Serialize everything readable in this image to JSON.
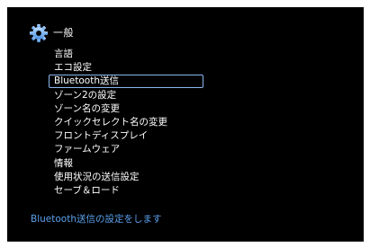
{
  "header": {
    "icon": "gear-icon",
    "title": "一般"
  },
  "menu": {
    "selected_index": 2,
    "items": [
      {
        "label": "言語"
      },
      {
        "label": "エコ設定"
      },
      {
        "label": "Bluetooth送信"
      },
      {
        "label": "ゾーン2の設定"
      },
      {
        "label": "ゾーン名の変更"
      },
      {
        "label": "クイックセレクト名の変更"
      },
      {
        "label": "フロントディスプレイ"
      },
      {
        "label": "ファームウェア"
      },
      {
        "label": "情報"
      },
      {
        "label": "使用状況の送信設定"
      },
      {
        "label": "セーブ＆ロード"
      }
    ]
  },
  "footer": {
    "help_text": "Bluetooth送信の設定をします"
  },
  "colors": {
    "background": "#000000",
    "text": "#ffffff",
    "accent": "#5aa0ec",
    "selection_border": "#8ab8f0"
  }
}
